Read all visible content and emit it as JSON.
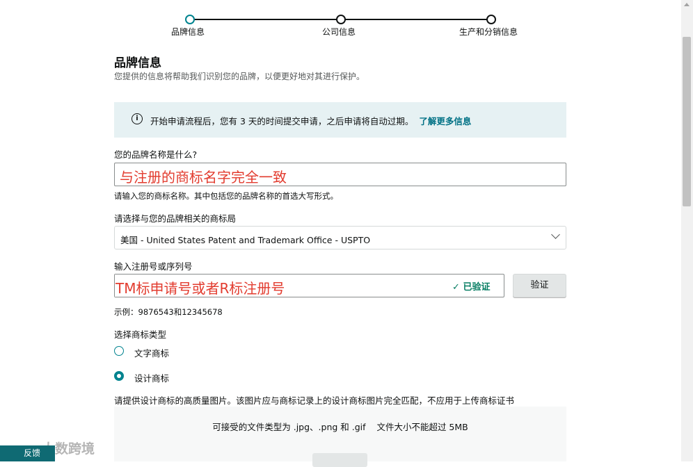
{
  "stepper": {
    "steps": [
      {
        "label": "品牌信息",
        "active": true
      },
      {
        "label": "公司信息",
        "active": false
      },
      {
        "label": "生产和分销信息",
        "active": false
      }
    ]
  },
  "header": {
    "title": "品牌信息",
    "subtitle": "您提供的信息将帮助我们识别您的品牌，以便更好地对其进行保护。"
  },
  "banner": {
    "text": "开始申请流程后，您有 3 天的时间提交申请，之后申请将自动过期。",
    "link": "了解更多信息"
  },
  "brand_name": {
    "label": "您的品牌名称是什么?",
    "value": "与注册的商标名字完全一致",
    "hint": "请输入您的商标名称。其中包括您的品牌名称的首选大写形式。"
  },
  "trademark_office": {
    "label": "请选择与您的品牌相关的商标局",
    "selected": "美国 - United States Patent and Trademark Office - USPTO"
  },
  "registration": {
    "label": "输入注册号或序列号",
    "value": "TM标申请号或者R标注册号",
    "verified": "已验证",
    "verify_button": "验证",
    "example": "示例：9876543和12345678"
  },
  "mark_type": {
    "label": "选择商标类型",
    "options": [
      {
        "label": "文字商标",
        "checked": false
      },
      {
        "label": "设计商标",
        "checked": true
      }
    ]
  },
  "upload": {
    "instruction": "请提供设计商标的高质量图片。该图片应与商标记录上的设计商标图片完全匹配，不应用于上传商标证书",
    "accepted": "可接受的文件类型为 .jpg、.png 和 .gif    文件大小不能超过 5MB"
  },
  "feedback": {
    "label": "反馈"
  },
  "watermark": {
    "text": "大数跨境"
  },
  "colors": {
    "accent": "#00838f",
    "link": "#007185",
    "verified": "#067d62",
    "annotation": "#e23b2e",
    "banner_bg": "#e6f1f3"
  }
}
